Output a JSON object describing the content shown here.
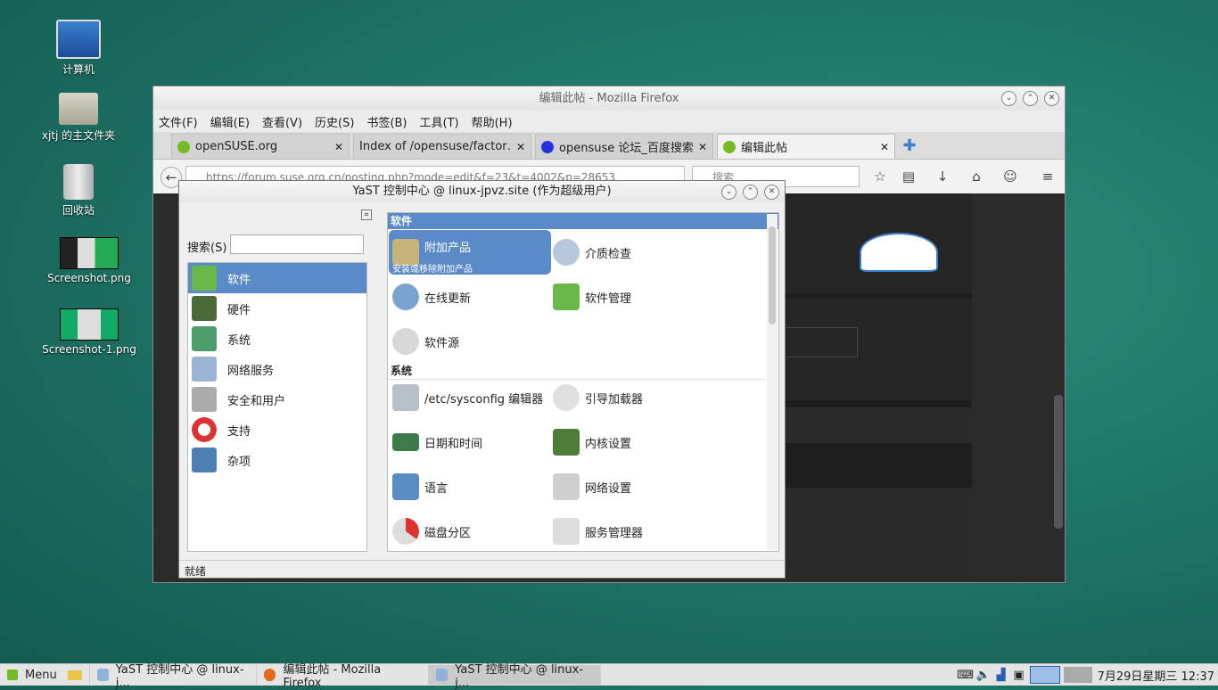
{
  "desktop": {
    "icons": [
      {
        "label": "计算机",
        "icon": "computer-icon"
      },
      {
        "label": "xjtj 的主文件夹",
        "icon": "home-folder-icon"
      },
      {
        "label": "回收站",
        "icon": "trash-icon"
      },
      {
        "label": "Screenshot.png",
        "icon": "image-file-icon"
      },
      {
        "label": "Screenshot-1.png",
        "icon": "image-file-icon"
      }
    ]
  },
  "firefox": {
    "title": "编辑此帖 - Mozilla Firefox",
    "menus": [
      "文件(F)",
      "编辑(E)",
      "查看(V)",
      "历史(S)",
      "书签(B)",
      "工具(T)",
      "帮助(H)"
    ],
    "tabs": [
      {
        "label": "openSUSE.org",
        "active": false
      },
      {
        "label": "Index of /opensuse/factor…",
        "active": false
      },
      {
        "label": "opensuse 论坛_百度搜索",
        "active": false
      },
      {
        "label": "编辑此帖",
        "active": true
      }
    ],
    "url": "https://forum.suse.org.cn/posting.php?mode=edit&f=23&t=4002&p=28653",
    "search_placeholder": "搜索"
  },
  "yast": {
    "title": "YaST 控制中心 @ linux-jpvz.site (作为超级用户)",
    "search_label": "搜索(S)",
    "search_value": "",
    "categories": [
      {
        "label": "软件",
        "selected": true
      },
      {
        "label": "硬件",
        "selected": false
      },
      {
        "label": "系统",
        "selected": false
      },
      {
        "label": "网络服务",
        "selected": false
      },
      {
        "label": "安全和用户",
        "selected": false
      },
      {
        "label": "支持",
        "selected": false
      },
      {
        "label": "杂项",
        "selected": false
      }
    ],
    "sections": {
      "software": "软件",
      "system": "系统"
    },
    "software_items": [
      {
        "label": "附加产品",
        "desc": "安装或移除附加产品"
      },
      {
        "label": "介质检查"
      },
      {
        "label": "在线更新"
      },
      {
        "label": "软件管理"
      },
      {
        "label": "软件源"
      }
    ],
    "system_items": [
      {
        "label": "/etc/sysconfig 编辑器"
      },
      {
        "label": "引导加载器"
      },
      {
        "label": "日期和时间"
      },
      {
        "label": "内核设置"
      },
      {
        "label": "语言"
      },
      {
        "label": "网络设置"
      },
      {
        "label": "磁盘分区"
      },
      {
        "label": "服务管理器"
      }
    ],
    "status": "就绪"
  },
  "taskbar": {
    "menu_label": "Menu",
    "tasks": [
      {
        "label": "YaST 控制中心 @ linux-j...",
        "active": false
      },
      {
        "label": "编辑此帖 - Mozilla Firefox",
        "active": false
      },
      {
        "label": "YaST 控制中心 @ linux-j...",
        "active": true
      }
    ],
    "clock": "7月29日星期三 12:37"
  },
  "colors": {
    "selection": "#5b8ac8",
    "desktop": "#1f7566"
  }
}
